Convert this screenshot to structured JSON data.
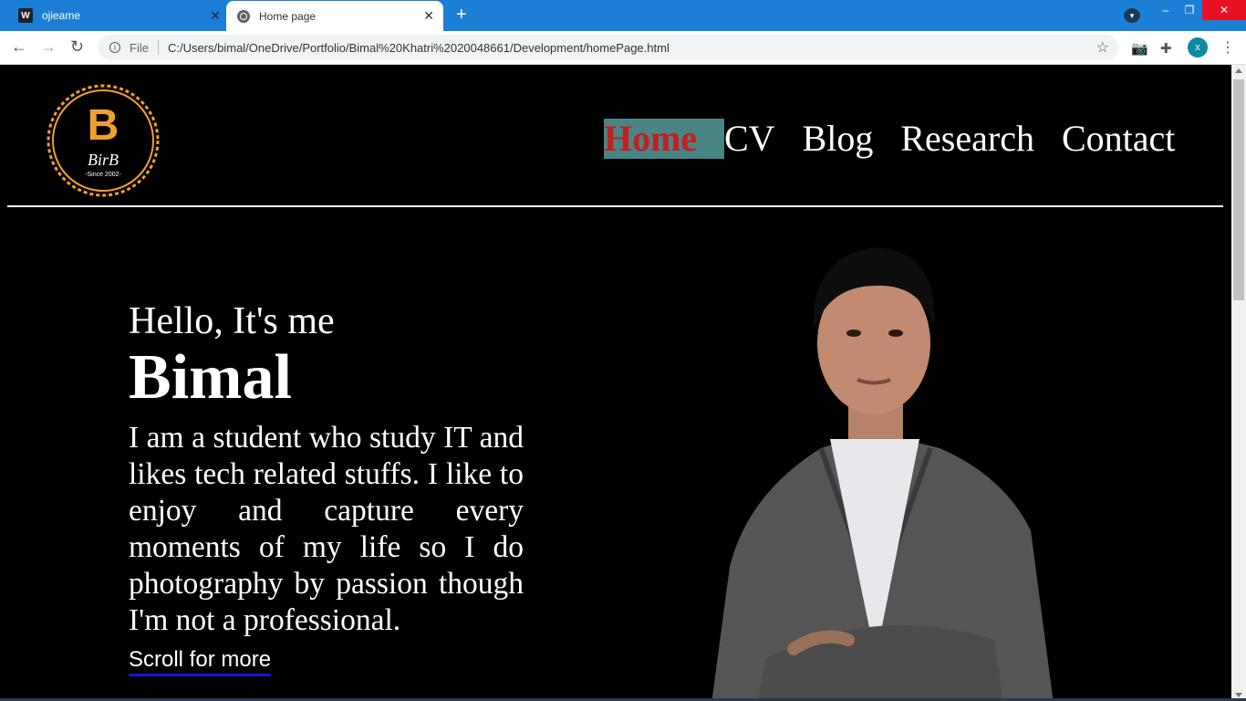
{
  "browser": {
    "tabs": [
      {
        "title": "ojieame",
        "favicon": "w-letter-icon",
        "active": false
      },
      {
        "title": "Home page",
        "favicon": "globe-icon",
        "active": true
      }
    ],
    "favicon_letter": "W",
    "close_glyph": "✕",
    "new_tab_glyph": "+",
    "window_controls": {
      "menu": "▾",
      "minimize": "–",
      "maximize": "❐",
      "close": "✕"
    },
    "address": {
      "scheme": "File",
      "url": "C:/Users/bimal/OneDrive/Portfolio/Bimal%20Khatri%2020048661/Development/homePage.html"
    },
    "profile_initial": "x",
    "accent": "#1c7fd6"
  },
  "site": {
    "logo": {
      "letter": "B",
      "wordmark": "BirB",
      "tagline": "-Since 2002-",
      "color": "#f0a030"
    },
    "nav": [
      {
        "label": "Home",
        "active": true
      },
      {
        "label": "CV",
        "active": false
      },
      {
        "label": "Blog",
        "active": false
      },
      {
        "label": "Research",
        "active": false
      },
      {
        "label": "Contact",
        "active": false
      }
    ],
    "hero": {
      "greeting": "Hello, It's me",
      "name": "Bimal",
      "bio": "I am a student who study IT and likes tech related stuffs. I like to enjoy and capture every moments of my life so I do photography by passion though I'm not a professional.",
      "scroll_link": "Scroll for more"
    },
    "colors": {
      "background": "#000000",
      "active_nav_bg": "#4a8585",
      "active_nav_text": "#c61e1e",
      "link_underline": "#1515e0"
    }
  }
}
